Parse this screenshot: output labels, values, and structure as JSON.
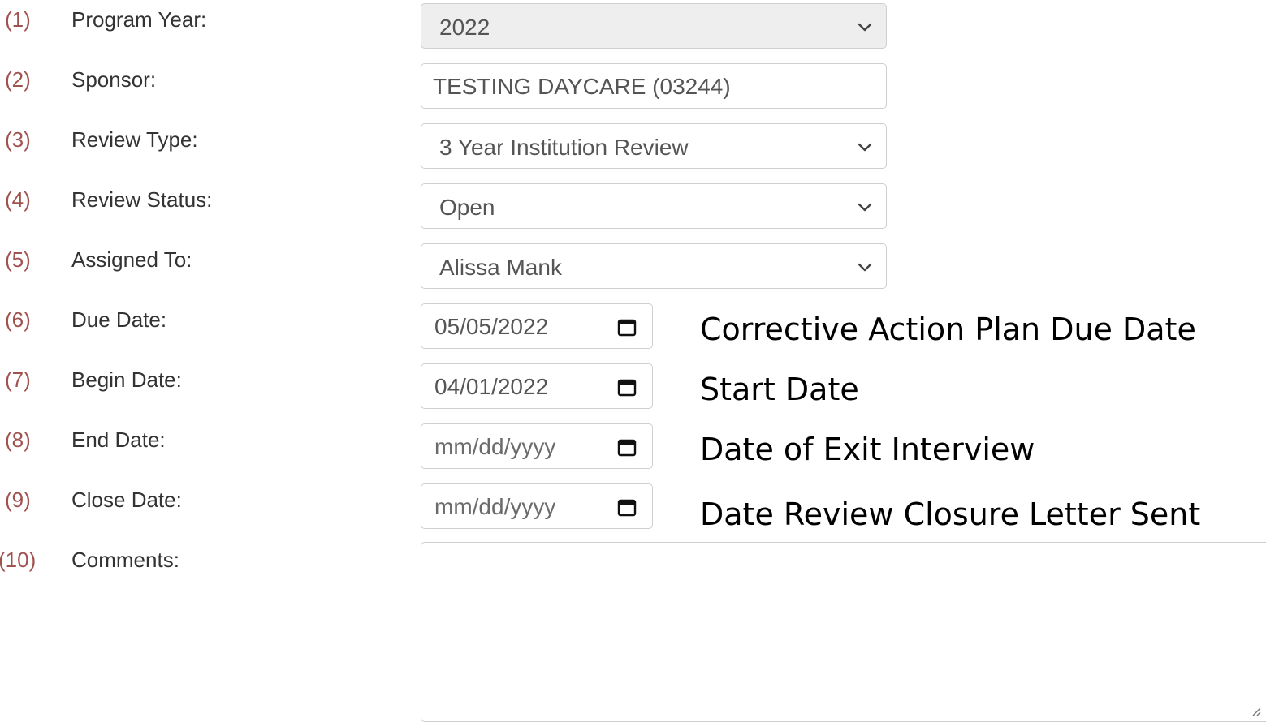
{
  "form": {
    "rows": [
      {
        "num": "(1)",
        "label": "Program Year:",
        "type": "select",
        "value": "2022",
        "disabled": true
      },
      {
        "num": "(2)",
        "label": "Sponsor:",
        "type": "text",
        "value": "TESTING DAYCARE (03244)"
      },
      {
        "num": "(3)",
        "label": "Review Type:",
        "type": "select",
        "value": "3 Year Institution Review"
      },
      {
        "num": "(4)",
        "label": "Review Status:",
        "type": "select",
        "value": "Open"
      },
      {
        "num": "(5)",
        "label": "Assigned To:",
        "type": "select",
        "value": "Alissa Mank"
      },
      {
        "num": "(6)",
        "label": "Due Date:",
        "type": "date",
        "value": "05/05/2022"
      },
      {
        "num": "(7)",
        "label": "Begin Date:",
        "type": "date",
        "value": "04/01/2022"
      },
      {
        "num": "(8)",
        "label": "End Date:",
        "type": "date",
        "value": "",
        "placeholder": "mm/dd/yyyy"
      },
      {
        "num": "(9)",
        "label": "Close Date:",
        "type": "date",
        "value": "",
        "placeholder": "mm/dd/yyyy"
      },
      {
        "num": "(10)",
        "label": "Comments:",
        "type": "textarea",
        "value": ""
      }
    ]
  },
  "annotations": {
    "due_date": "Corrective Action Plan Due Date",
    "begin_date": "Start Date",
    "end_date": "Date of Exit Interview",
    "close_date": "Date Review Closure Letter Sent"
  },
  "icons": {
    "dropdown": "chevron-down-icon",
    "date_picker": "calendar-icon",
    "resize": "resize-grip-icon"
  },
  "colors": {
    "row_number": "#a0524f",
    "label": "#333333",
    "disabled_background": "#eeeeee",
    "border": "#cfcfcf"
  }
}
